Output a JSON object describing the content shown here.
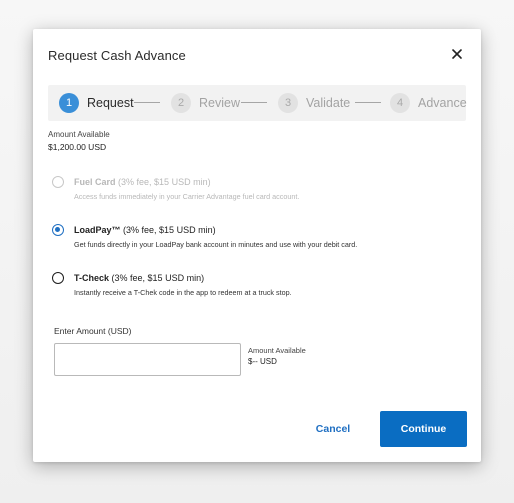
{
  "modal": {
    "title": "Request Cash Advance",
    "close_icon": "close-icon"
  },
  "stepper": {
    "steps": [
      {
        "number": "1",
        "label": "Request",
        "active": true
      },
      {
        "number": "2",
        "label": "Review",
        "active": false
      },
      {
        "number": "3",
        "label": "Validate",
        "active": false
      },
      {
        "number": "4",
        "label": "Advance",
        "active": false
      }
    ]
  },
  "available": {
    "label": "Amount Available",
    "value": "$1,200.00 USD"
  },
  "options": [
    {
      "name": "Fuel Card",
      "fee": "(3% fee, $15 USD min)",
      "description": "Access funds immediately in your Carrier Advantage fuel card account.",
      "state": "disabled"
    },
    {
      "name": "LoadPay™",
      "fee": "(3% fee, $15 USD min)",
      "description": "Get funds directly in your LoadPay bank account in minutes and use with your debit card.",
      "state": "checked"
    },
    {
      "name": "T-Check",
      "fee": "(3% fee, $15 USD min)",
      "description": "Instantly receive a T-Chek code in the app to redeem at a truck stop.",
      "state": "unchecked"
    }
  ],
  "amount": {
    "label": "Enter Amount (USD)",
    "value": "",
    "placeholder": "",
    "available_label": "Amount Available",
    "available_value": "$-- USD"
  },
  "actions": {
    "cancel_label": "Cancel",
    "continue_label": "Continue"
  },
  "colors": {
    "primary": "#0a6dc2",
    "active_step": "#3a8fd8",
    "disabled_text": "#b8b8b8"
  }
}
